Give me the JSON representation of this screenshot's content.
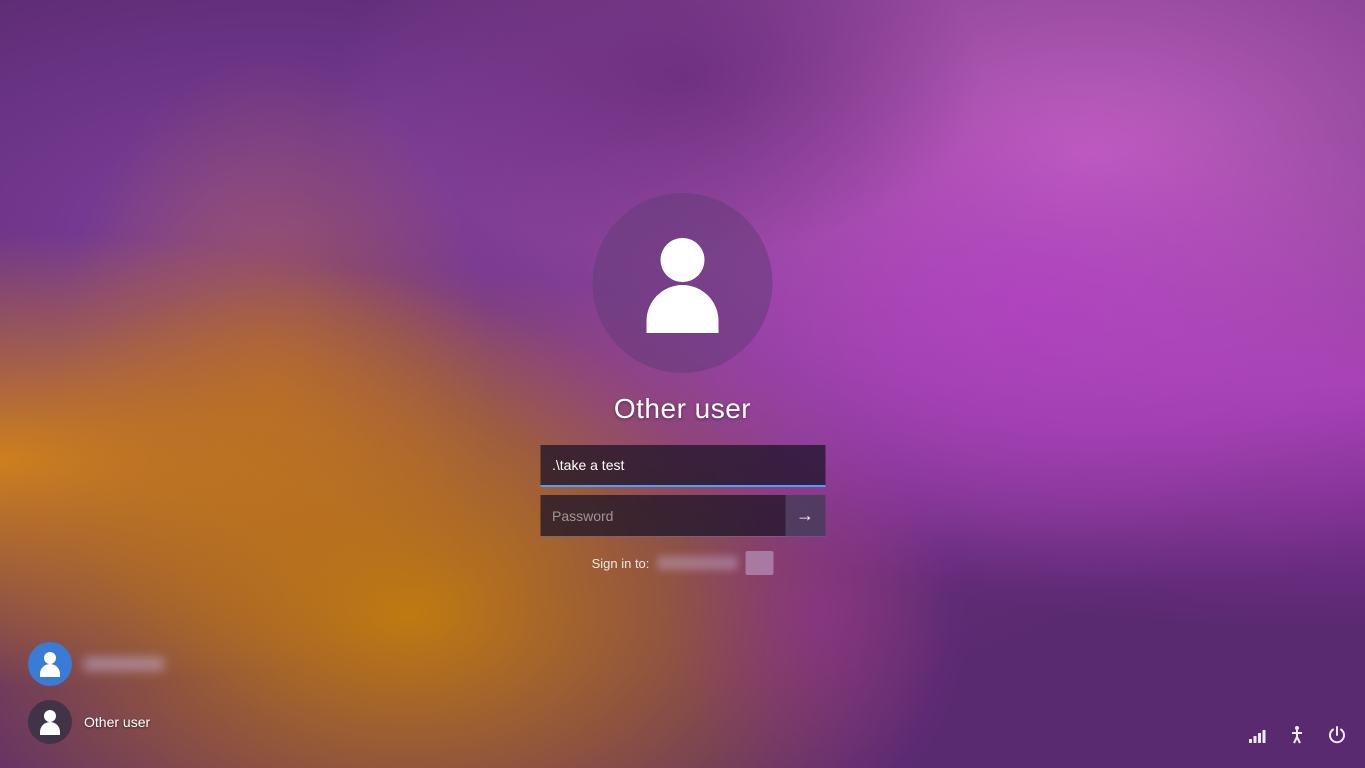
{
  "wallpaper": {
    "description": "Windows 11 purple orange swirl wallpaper"
  },
  "login": {
    "username_label": "Other user",
    "username_value": ".\\take a test",
    "password_placeholder": "Password",
    "sign_in_to_label": "Sign in to:",
    "sign_in_arrow": "→"
  },
  "bottom_users": [
    {
      "id": "current-user",
      "name_blurred": true,
      "avatar_type": "blue"
    },
    {
      "id": "other-user",
      "name": "Other user",
      "avatar_type": "dark"
    }
  ],
  "system_icons": {
    "network_label": "Network",
    "accessibility_label": "Accessibility",
    "power_label": "Power"
  }
}
